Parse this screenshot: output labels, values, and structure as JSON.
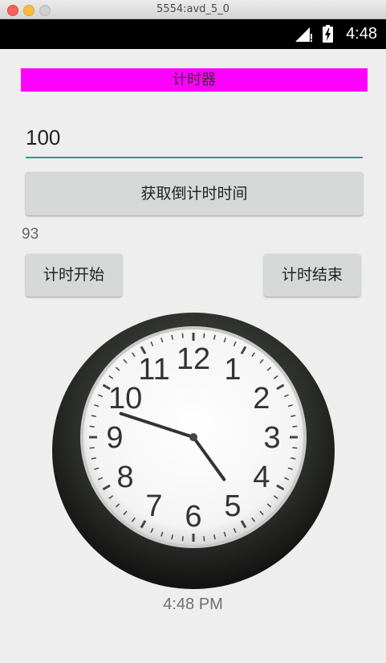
{
  "window": {
    "title": "5554:avd_5_0"
  },
  "status_bar": {
    "time": "4:48"
  },
  "app": {
    "banner_title": "计时器",
    "input_value": "100",
    "get_time_button": "获取倒计时时间",
    "countdown_value": "93",
    "start_button": "计时开始",
    "stop_button": "计时结束"
  },
  "clock": {
    "numerals": [
      "12",
      "1",
      "2",
      "3",
      "4",
      "5",
      "6",
      "7",
      "8",
      "9",
      "10",
      "11"
    ],
    "hour": 4,
    "minute": 48,
    "time_text": "4:48 PM"
  }
}
